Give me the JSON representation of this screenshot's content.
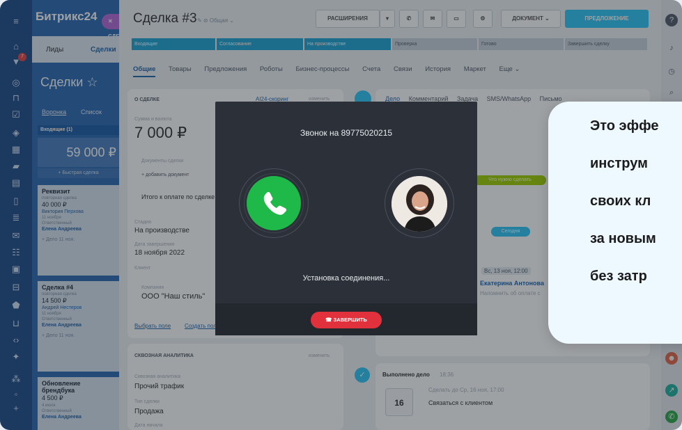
{
  "left": {
    "brand": "Битрикс24",
    "deal_pill": "✕ СДЕЛКА",
    "tabs": [
      "Лиды",
      "Сделки"
    ],
    "title": "Сделки ☆",
    "views": [
      "Воронка",
      "Список"
    ],
    "stage_label": "Входящие (1)",
    "stage_sum": "59 000 ₽",
    "quick_add": "+ Быстрая сделка",
    "cards": [
      {
        "title": "Реквизит",
        "sub": "повторная сделка",
        "amount": "40 000 ₽",
        "person": "Виктория Перхова",
        "date": "11 ноября",
        "resp_label": "Ответственный",
        "resp": "Елена Андреева",
        "footer": "+ Дело      11 ноя."
      },
      {
        "title": "Сделка #4",
        "sub": "повторная сделка",
        "amount": "14 500 ₽",
        "person": "Андрей Нестеров",
        "date": "11 ноября",
        "resp_label": "Ответственный",
        "resp": "Елена Андреева",
        "footer": "+ Дело      11 ноя."
      },
      {
        "title": "Обновление брендбука",
        "sub": "",
        "amount": "4 500 ₽",
        "person": "",
        "date": "4 июля",
        "resp_label": "Ответственный",
        "resp": "Елена Андреева",
        "footer": ""
      }
    ]
  },
  "header": {
    "title": "Сделка #3",
    "subtitle": "✎ ⊘ Общая ⌄",
    "btn_ext": "РАСШИРЕНИЯ",
    "btn_doc": "ДОКУМЕНТ ⌄",
    "btn_offer": "ПРЕДЛОЖЕНИЕ"
  },
  "stages": [
    "Входящие",
    "Согласование",
    "На производстве",
    "Проверка",
    "Готово",
    "Завершить сделку"
  ],
  "subnav": [
    "Общие",
    "Товары",
    "Предложения",
    "Роботы",
    "Бизнес-процессы",
    "Счета",
    "Связи",
    "История",
    "Маркет",
    "Еще ⌄"
  ],
  "about": {
    "header": "О СДЕЛКЕ",
    "scoring": "AI24-скоринг",
    "edit": "изменить",
    "sum_label": "Сумма и валюта",
    "sum": "7 000 ₽",
    "docs_label": "Документы сделки",
    "docs_add": "+ добавить документ",
    "total_label": "Итого к оплате по сделке",
    "stage_label": "Стадия",
    "stage": "На производстве",
    "close_label": "Дата завершения",
    "close": "18 ноября 2022",
    "client_label": "Клиент",
    "company_label": "Компания",
    "company": "ООО \"Наш стиль\"",
    "choose_field": "Выбрать поле",
    "create_field": "Создать поле"
  },
  "analytics": {
    "header": "СКВОЗНАЯ АНАЛИТИКА",
    "edit": "изменить",
    "a_label": "Сквозная аналитика",
    "a_val": "Прочий трафик",
    "type_label": "Тип сделки",
    "type_val": "Продажа",
    "start_label": "Дата начала"
  },
  "feed": {
    "tabs": [
      "Дело",
      "Комментарий",
      "Задача",
      "SMS/WhatsApp",
      "Письмо"
    ],
    "todo_badge": "Что нужно сделать",
    "today": "Сегодня",
    "event_date": "Вс, 13 ноя, 12:00",
    "event_person": "Екатерина Антонова",
    "event_text": "Напомнить об оплате с",
    "done_label": "Выполнено дело",
    "done_time": "18:36",
    "done_due": "Сделать до  Ср, 16 ноя, 17:00",
    "done_text": "Связаться с клиентом",
    "cal_day": "16"
  },
  "call": {
    "title": "Звонок на 89775020215",
    "status": "Установка соединения...",
    "end_label": "ЗАВЕРШИТЬ"
  },
  "promo": {
    "lines": [
      "Это эффе",
      "инструм",
      "своих кл",
      "за новым",
      "без затр"
    ]
  }
}
